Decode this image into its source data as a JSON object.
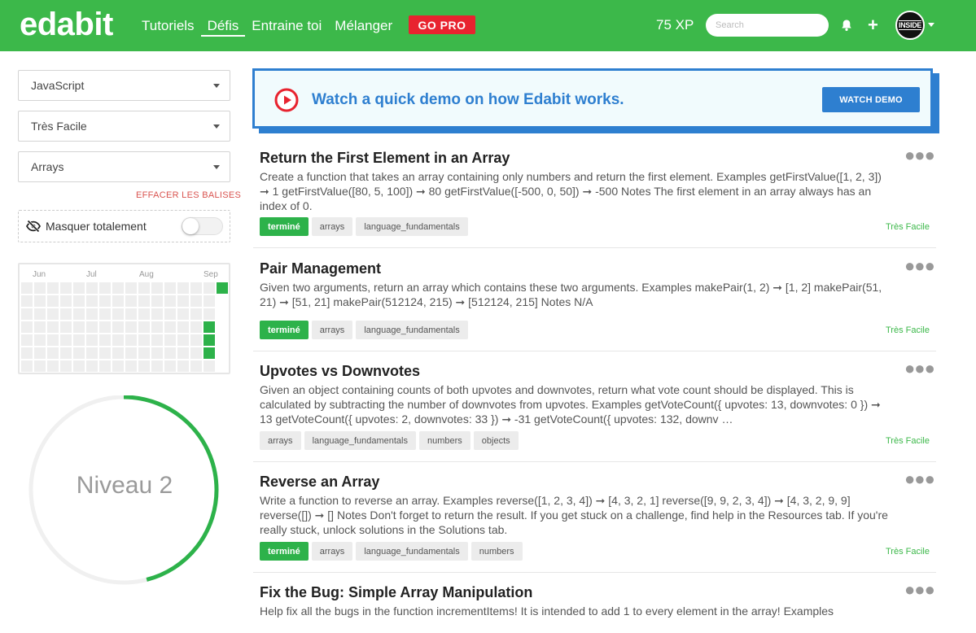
{
  "header": {
    "logo": "edabit",
    "nav": [
      "Tutoriels",
      "Défis",
      "Entraine toi",
      "Mélanger"
    ],
    "go_pro": "GO PRO",
    "xp": "75 XP",
    "search_placeholder": "Search",
    "avatar_text": "INSIDE",
    "accent": "#3cb84a"
  },
  "sidebar": {
    "language": "JavaScript",
    "difficulty": "Très Facile",
    "tag": "Arrays",
    "clear_tags": "EFFACER LES BALISES",
    "hide_label": "Masquer totalement",
    "hide_enabled": false,
    "months": [
      "Jun",
      "Jul",
      "Aug",
      "Sep"
    ],
    "level_text": "Niveau 2",
    "level_progress": 0.46
  },
  "banner": {
    "text": "Watch a quick demo on how Edabit works.",
    "button": "WATCH DEMO"
  },
  "challenges": [
    {
      "title": "Return the First Element in an Array",
      "desc": "Create a function that takes an array containing only numbers and return the first element. Examples getFirstValue([1, 2, 3]) ➞ 1 getFirstValue([80, 5, 100]) ➞ 80 getFirstValue([-500, 0, 50]) ➞ -500 Notes The first element in an array always has an index of 0.",
      "tags": [
        "terminé",
        "arrays",
        "language_fundamentals"
      ],
      "difficulty": "Très Facile"
    },
    {
      "title": "Pair Management",
      "desc": "Given two arguments, return an array which contains these two arguments. Examples makePair(1, 2) ➞ [1, 2] makePair(51, 21) ➞ [51, 21] makePair(512124, 215) ➞ [512124, 215] Notes N/A",
      "tags": [
        "terminé",
        "arrays",
        "language_fundamentals"
      ],
      "difficulty": "Très Facile"
    },
    {
      "title": "Upvotes vs Downvotes",
      "desc": "Given an object containing counts of both upvotes and downvotes, return what vote count should be displayed. This is calculated by subtracting the number of downvotes from upvotes. Examples getVoteCount({ upvotes: 13, downvotes: 0 }) ➞ 13 getVoteCount({ upvotes: 2, downvotes: 33 }) ➞ -31 getVoteCount({ upvotes: 132, downv …",
      "tags": [
        "arrays",
        "language_fundamentals",
        "numbers",
        "objects"
      ],
      "difficulty": "Très Facile"
    },
    {
      "title": "Reverse an Array",
      "desc": "Write a function to reverse an array. Examples reverse([1, 2, 3, 4]) ➞ [4, 3, 2, 1] reverse([9, 9, 2, 3, 4]) ➞ [4, 3, 2, 9, 9] reverse([]) ➞ [] Notes Don't forget to return the result. If you get stuck on a challenge, find help in the Resources tab. If you're really stuck, unlock solutions in the Solutions tab.",
      "tags": [
        "terminé",
        "arrays",
        "language_fundamentals",
        "numbers"
      ],
      "difficulty": "Très Facile"
    },
    {
      "title": "Fix the Bug: Simple Array Manipulation",
      "desc": "Help fix all the bugs in the function incrementItems! It is intended to add 1 to every element in the array! Examples",
      "tags": [],
      "difficulty": ""
    }
  ]
}
